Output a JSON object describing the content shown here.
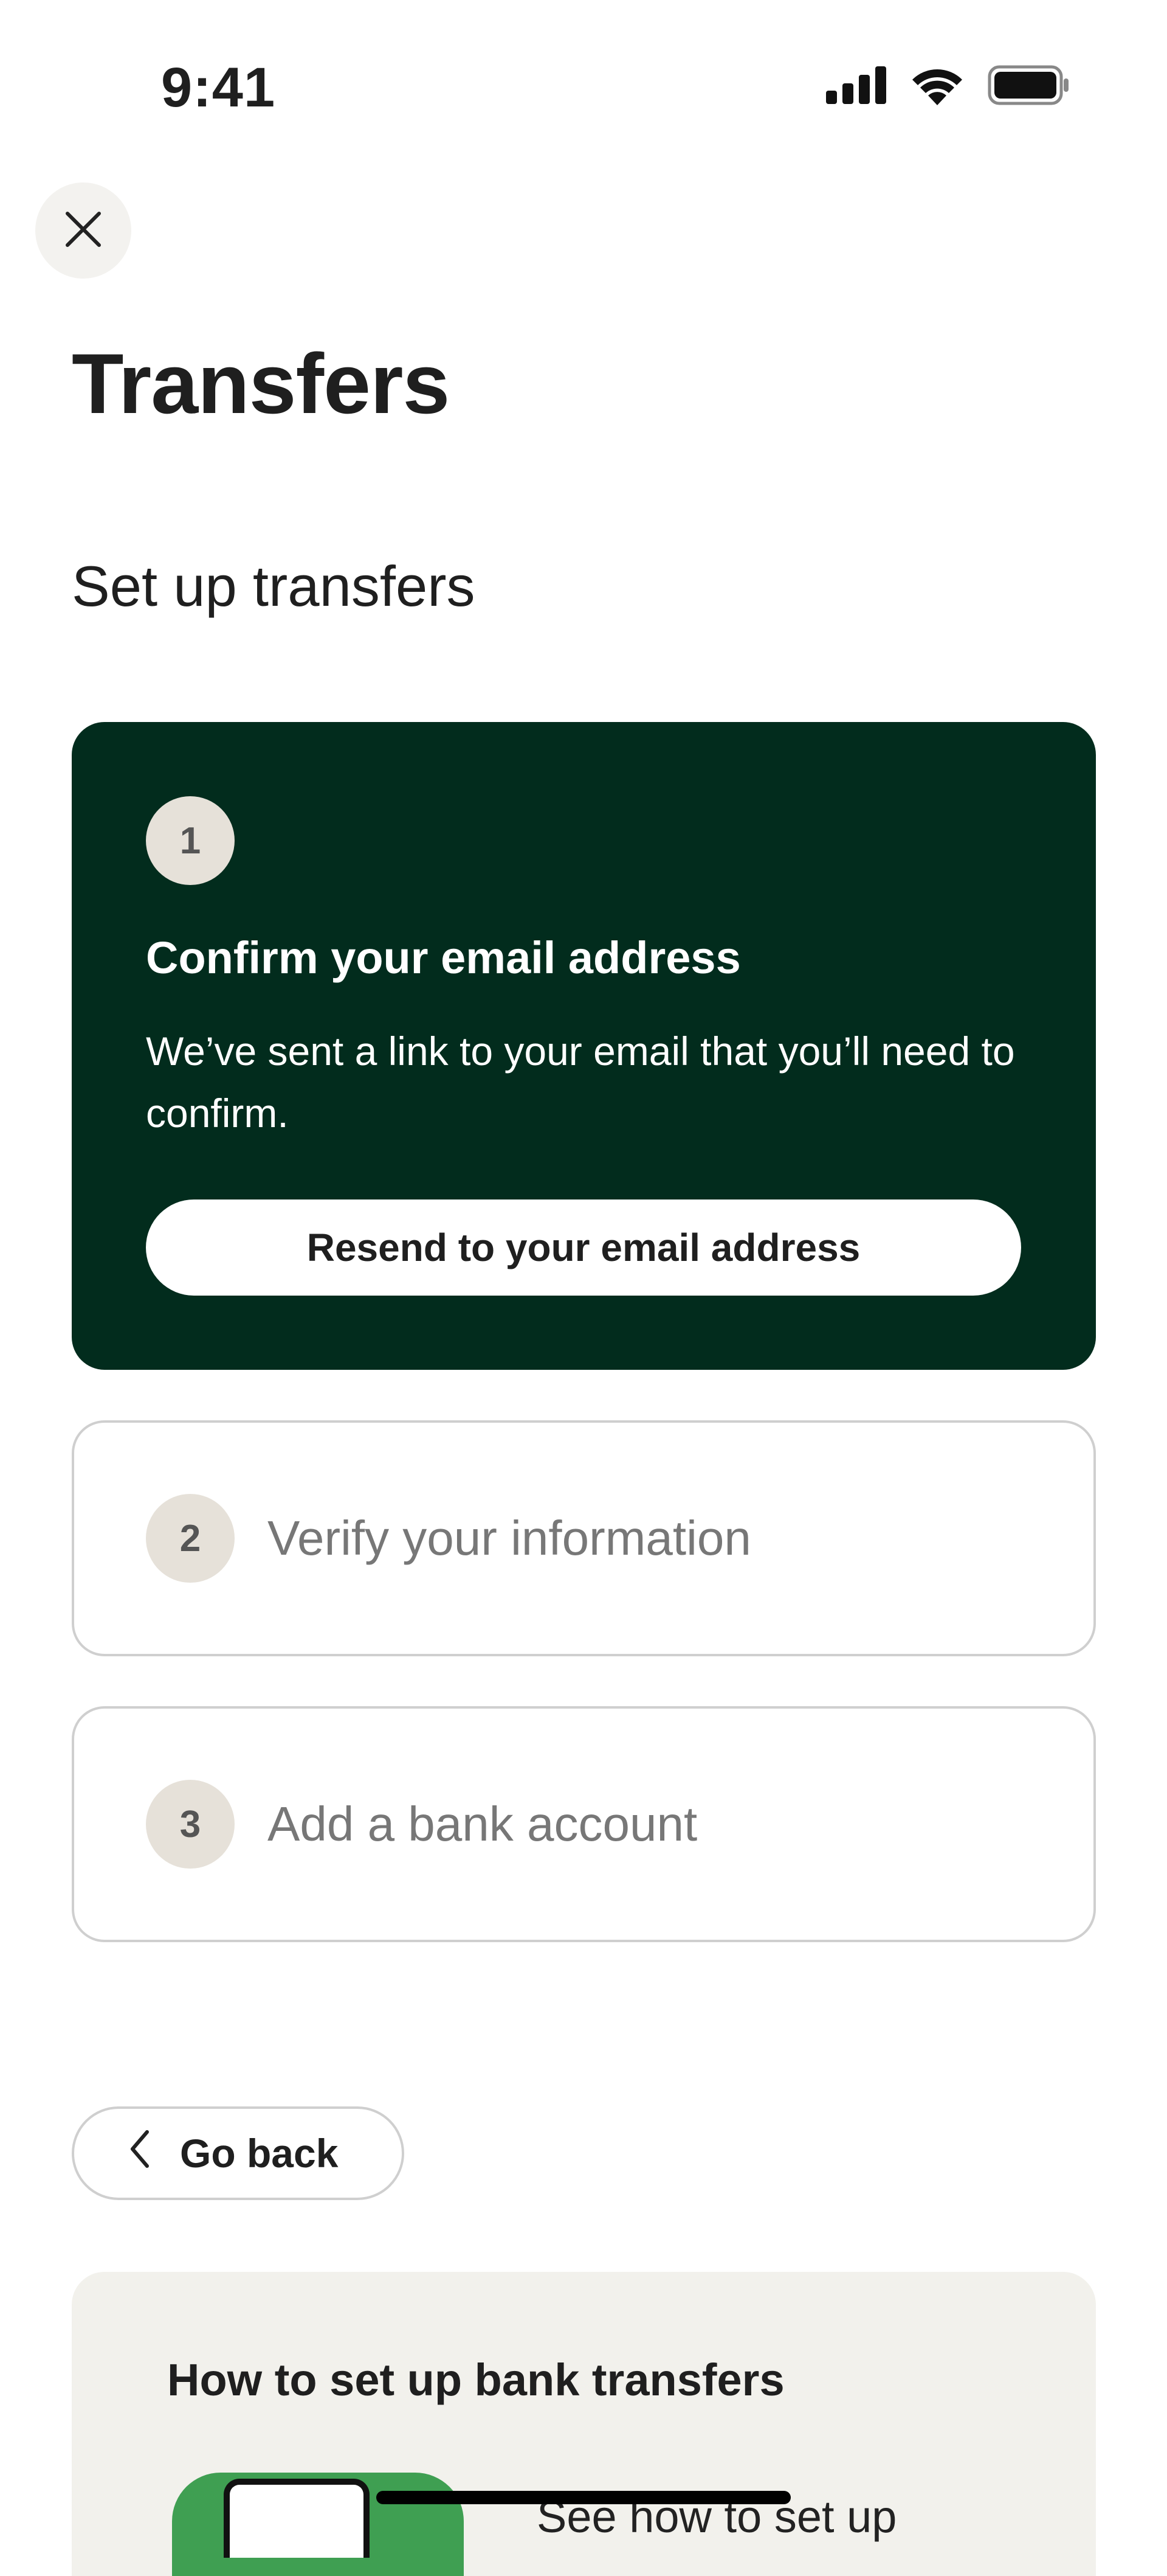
{
  "status_bar": {
    "time": "9:41",
    "icons": [
      "signal-icon",
      "wifi-icon",
      "battery-icon"
    ]
  },
  "header": {
    "close_icon": "close-icon",
    "title": "Transfers"
  },
  "setup": {
    "section_title": "Set up transfers",
    "steps": [
      {
        "number": "1",
        "title": "Confirm your email address",
        "description": "We’ve sent a link to your email that you’ll need to confirm.",
        "button_label": "Resend to your email address",
        "state": "active"
      },
      {
        "number": "2",
        "title": "Verify your information",
        "state": "pending"
      },
      {
        "number": "3",
        "title": "Add a bank account",
        "state": "pending"
      }
    ]
  },
  "navigation": {
    "back_label": "Go back",
    "back_icon": "chevron-left-icon"
  },
  "help": {
    "title": "How to set up bank transfers",
    "link_text": "See how to set up"
  },
  "colors": {
    "active_card": "#022c1d",
    "badge": "#e6e1d9",
    "help_background": "#f2f1ec",
    "thumbnail_green": "#3f9f52"
  }
}
